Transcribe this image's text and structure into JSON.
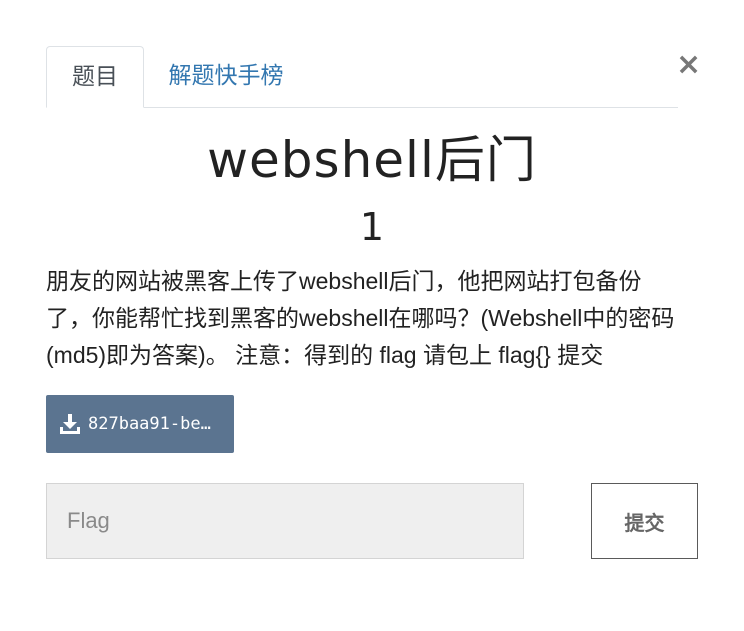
{
  "tabs": [
    {
      "label": "题目",
      "active": true
    },
    {
      "label": "解题快手榜",
      "active": false
    }
  ],
  "close_label": "×",
  "challenge": {
    "title": "webshell后门",
    "points": "1",
    "description": "朋友的网站被黑客上传了webshell后门，他把网站打包备份了，你能帮忙找到黑客的webshell在哪吗？(Webshell中的密码(md5)即为答案)。 注意：得到的 flag 请包上 flag{} 提交"
  },
  "file": {
    "label": "827baa91-be…",
    "icon": "download-icon"
  },
  "flag_input": {
    "placeholder": "Flag",
    "value": ""
  },
  "submit_label": "提交",
  "colors": {
    "tab_link": "#3377b0",
    "file_button": "#5b7490",
    "input_background": "#efefef"
  }
}
